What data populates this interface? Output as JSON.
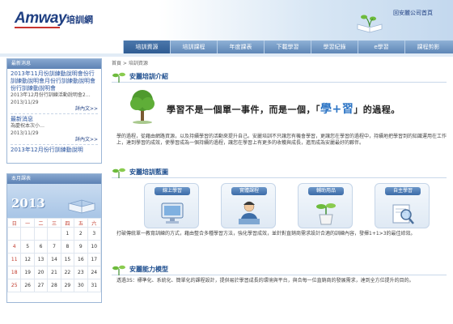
{
  "header": {
    "logo": "Amway",
    "logo_sub": "培訓網",
    "home_link": "回安麗公司首頁"
  },
  "nav": {
    "items": [
      {
        "label": "培訓資源",
        "active": true
      },
      {
        "label": "培訓課程",
        "active": false
      },
      {
        "label": "年度課表",
        "active": false
      },
      {
        "label": "下載學習",
        "active": false
      },
      {
        "label": "學習紀錄",
        "active": false
      },
      {
        "label": "e學習",
        "active": false
      },
      {
        "label": "課程剪影",
        "active": false
      }
    ]
  },
  "news": {
    "title": "最新消息",
    "item1_link": "2013年11月份訓練動說明會份行訓練動說明會月份行訓練動說明會份行訓練動說明會",
    "item1_sub": "2013年12月份行訓練活動說明會2…",
    "item1_date": "2013/11/29",
    "more1": "詳內文>>",
    "item2_link": "最新消息",
    "item2_sub": "為慶祝本次小…",
    "item2_date": "2013/11/29",
    "more2": "詳內文>>",
    "item3_link": "2013年12月份行訓練動說明"
  },
  "calendar": {
    "title": "本月課表",
    "year": "2013",
    "weekdays": [
      "日",
      "一",
      "二",
      "三",
      "四",
      "五",
      "六"
    ],
    "weeks": [
      [
        "",
        "",
        "",
        "",
        "1",
        "2",
        "3"
      ],
      [
        "4",
        "5",
        "6",
        "7",
        "8",
        "9",
        "10"
      ],
      [
        "11",
        "12",
        "13",
        "14",
        "15",
        "16",
        "17"
      ],
      [
        "18",
        "19",
        "20",
        "21",
        "22",
        "23",
        "24"
      ],
      [
        "25",
        "26",
        "27",
        "28",
        "29",
        "30",
        "31"
      ]
    ]
  },
  "breadcrumb": "首頁 > 培訓資源",
  "sections": {
    "intro_title": "安麗培訓介紹",
    "quote_pre": "學習不是一個單一事件，而是一個，「",
    "quote_big": "學+習",
    "quote_post": "」的過程。",
    "intro_text": "學的過程，從藉由網路資源，以及持續學習的活動來提升自己。安麗培訓不只讓您有機會學習，更讓您在學習的過程中，持續地把學習到的知識運用在工作上，達到學習的成效，使學習成為一個持續的過程，讓您在學習上有更多的收穫與成長，進而成為安麗最好的夥伴。",
    "sys_title": "安麗培訓藍圖",
    "cards": [
      {
        "label": "線上學習",
        "icon": "monitor-icon"
      },
      {
        "label": "實體課程",
        "icon": "instructor-icon"
      },
      {
        "label": "輔助用品",
        "icon": "plant-pot-icon"
      },
      {
        "label": "自主學習",
        "icon": "magnifier-icon"
      }
    ],
    "sys_text": "打破傳統單一教育訓練的方式，藉由整合多種學習方法，強化學習成效，並針對直銷商需求設計合適的訓練內容，發揮1+1>3的最佳綜效。",
    "model_title": "安麗能力模型",
    "model_text": "透過3S：標準化、系統化、簡單化的課程設計，提供易於學習成長的環境與平台，與合每一位直銷商的發展需求，達到全方位提升的目的。"
  }
}
